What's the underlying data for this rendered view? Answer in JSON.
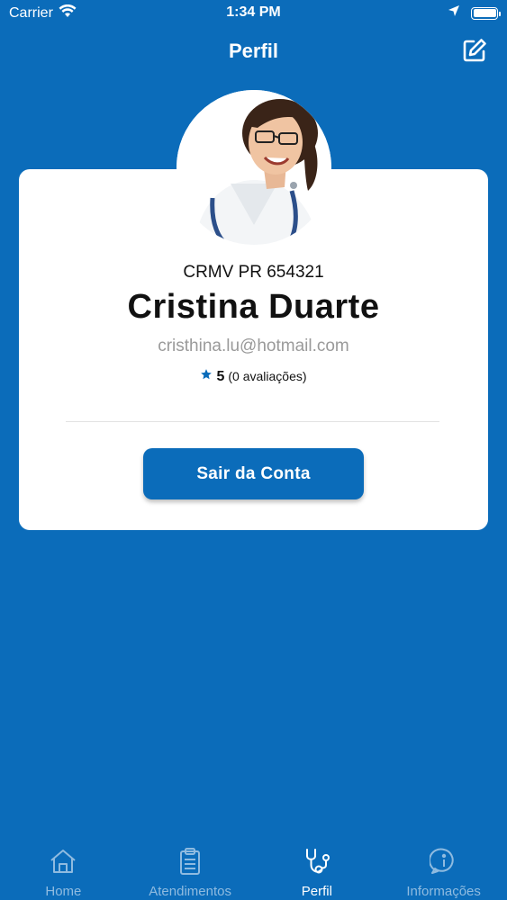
{
  "status_bar": {
    "carrier": "Carrier",
    "time": "1:34 PM"
  },
  "header": {
    "title": "Perfil",
    "edit_icon": "edit-icon"
  },
  "profile": {
    "crmv": "CRMV PR 654321",
    "name": "Cristina Duarte",
    "email": "cristhina.lu@hotmail.com",
    "rating_value": "5",
    "rating_count_text": "(0 avaliações)",
    "star_color": "#0b6cba"
  },
  "actions": {
    "logout_label": "Sair da Conta"
  },
  "tabs": [
    {
      "label": "Home",
      "icon": "home-icon",
      "active": false
    },
    {
      "label": "Atendimentos",
      "icon": "clipboard-icon",
      "active": false
    },
    {
      "label": "Perfil",
      "icon": "stethoscope-icon",
      "active": true
    },
    {
      "label": "Informações",
      "icon": "info-icon",
      "active": false
    }
  ],
  "colors": {
    "primary": "#0b6cba",
    "card": "#ffffff",
    "muted_text": "#9a9a9a",
    "inactive_tab": "#8fbbe0"
  }
}
